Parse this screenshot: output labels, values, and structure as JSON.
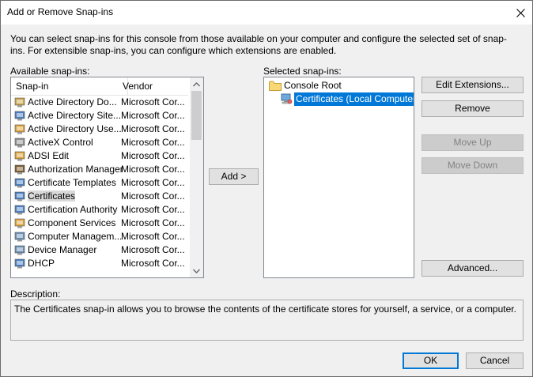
{
  "window": {
    "title": "Add or Remove Snap-ins"
  },
  "intro_text": "You can select snap-ins for this console from those available on your computer and configure the selected set of snap-ins. For extensible snap-ins, you can configure which extensions are enabled.",
  "available": {
    "label": "Available snap-ins:",
    "columns": {
      "snapin": "Snap-in",
      "vendor": "Vendor"
    },
    "items": [
      {
        "name": "Active Directory Do...",
        "vendor": "Microsoft Cor...",
        "icon": "ad-domains-icon"
      },
      {
        "name": "Active Directory Site...",
        "vendor": "Microsoft Cor...",
        "icon": "ad-sites-icon"
      },
      {
        "name": "Active Directory Use...",
        "vendor": "Microsoft Cor...",
        "icon": "ad-users-icon"
      },
      {
        "name": "ActiveX Control",
        "vendor": "Microsoft Cor...",
        "icon": "activex-icon"
      },
      {
        "name": "ADSI Edit",
        "vendor": "Microsoft Cor...",
        "icon": "adsi-edit-icon"
      },
      {
        "name": "Authorization Manager",
        "vendor": "Microsoft Cor...",
        "icon": "authorization-icon"
      },
      {
        "name": "Certificate Templates",
        "vendor": "Microsoft Cor...",
        "icon": "cert-templates-icon"
      },
      {
        "name": "Certificates",
        "vendor": "Microsoft Cor...",
        "icon": "certificates-icon"
      },
      {
        "name": "Certification Authority",
        "vendor": "Microsoft Cor...",
        "icon": "cert-authority-icon"
      },
      {
        "name": "Component Services",
        "vendor": "Microsoft Cor...",
        "icon": "component-services-icon"
      },
      {
        "name": "Computer Managem...",
        "vendor": "Microsoft Cor...",
        "icon": "computer-management-icon"
      },
      {
        "name": "Device Manager",
        "vendor": "Microsoft Cor...",
        "icon": "device-manager-icon"
      },
      {
        "name": "DHCP",
        "vendor": "Microsoft Cor...",
        "icon": "dhcp-icon"
      }
    ],
    "selected_index": 7
  },
  "add_button": "Add >",
  "selected": {
    "label": "Selected snap-ins:",
    "root": "Console Root",
    "child": "Certificates (Local Computer)"
  },
  "buttons": {
    "edit_extensions": "Edit Extensions...",
    "remove": "Remove",
    "move_up": "Move Up",
    "move_down": "Move Down",
    "advanced": "Advanced...",
    "ok": "OK",
    "cancel": "Cancel"
  },
  "description": {
    "label": "Description:",
    "text": "The Certificates snap-in allows you to browse the contents of the certificate stores for yourself, a service, or a computer."
  },
  "colors": {
    "selection": "#0078d7",
    "accent": "#0078d7"
  }
}
